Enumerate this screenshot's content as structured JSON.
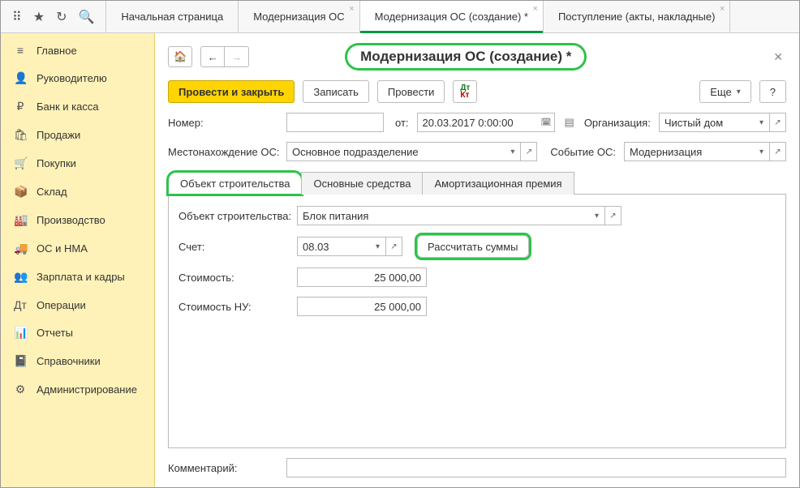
{
  "tabs": [
    {
      "label": "Начальная страница",
      "closable": false,
      "active": false
    },
    {
      "label": "Модернизация ОС",
      "closable": true,
      "active": false
    },
    {
      "label": "Модернизация ОС (создание) *",
      "closable": true,
      "active": true
    },
    {
      "label": "Поступление (акты, накладные)",
      "closable": true,
      "active": false
    }
  ],
  "sidebar": [
    {
      "icon": "≡",
      "label": "Главное"
    },
    {
      "icon": "👤",
      "label": "Руководителю"
    },
    {
      "icon": "₽",
      "label": "Банк и касса"
    },
    {
      "icon": "🛍",
      "label": "Продажи"
    },
    {
      "icon": "🛒",
      "label": "Покупки"
    },
    {
      "icon": "📦",
      "label": "Склад"
    },
    {
      "icon": "🏭",
      "label": "Производство"
    },
    {
      "icon": "🚚",
      "label": "ОС и НМА"
    },
    {
      "icon": "👥",
      "label": "Зарплата и кадры"
    },
    {
      "icon": "Дт",
      "label": "Операции"
    },
    {
      "icon": "📊",
      "label": "Отчеты"
    },
    {
      "icon": "📓",
      "label": "Справочники"
    },
    {
      "icon": "⚙",
      "label": "Администрирование"
    }
  ],
  "page": {
    "title": "Модернизация ОС (создание) *",
    "toolbar": {
      "post_close": "Провести и закрыть",
      "save": "Записать",
      "post": "Провести",
      "more": "Еще",
      "help": "?"
    },
    "fields": {
      "number_label": "Номер:",
      "number_value": "",
      "from_label": "от:",
      "date_value": "20.03.2017  0:00:00",
      "org_label": "Организация:",
      "org_value": "Чистый дом",
      "location_label": "Местонахождение ОС:",
      "location_value": "Основное подразделение",
      "event_label": "Событие ОС:",
      "event_value": "Модернизация"
    },
    "inner_tabs": [
      {
        "label": "Объект строительства",
        "active": true,
        "highlight": true
      },
      {
        "label": "Основные средства",
        "active": false,
        "highlight": false
      },
      {
        "label": "Амортизационная премия",
        "active": false,
        "highlight": false
      }
    ],
    "obj_tab": {
      "object_label": "Объект строительства:",
      "object_value": "Блок питания",
      "account_label": "Счет:",
      "account_value": "08.03",
      "calc_button": "Рассчитать суммы",
      "cost_label": "Стоимость:",
      "cost_value": "25 000,00",
      "cost_nu_label": "Стоимость НУ:",
      "cost_nu_value": "25 000,00"
    },
    "comment_label": "Комментарий:",
    "comment_value": ""
  }
}
